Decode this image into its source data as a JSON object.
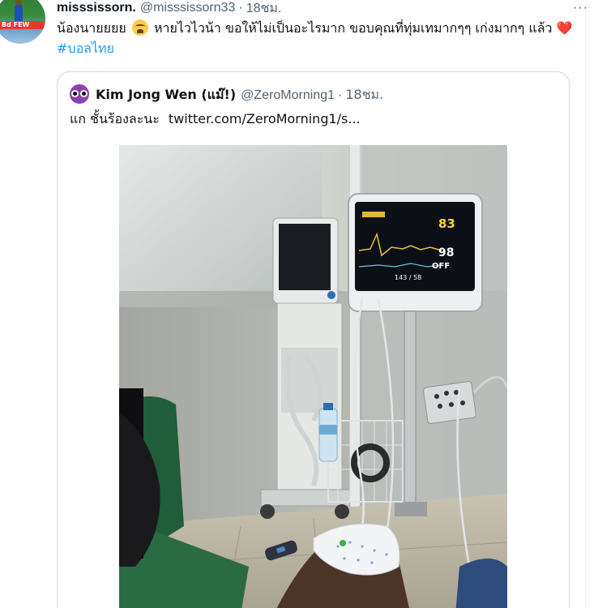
{
  "tweet": {
    "display_name": "misssissorn.",
    "handle": "@misssissorn33",
    "separator": "·",
    "time": "18ชม.",
    "more": "···",
    "text_part1": "น้องนายยยย ",
    "emoji": "tired-face-emoji",
    "text_part2": " หายไวไวน้า ขอให้ไม่เป็นอะไรมาก ขอบคุณที่ทุ่มเทมากๆๆ เก่งมากๆ แล้ว ",
    "heart": "❤️",
    "hashtag": "#บอลไทย",
    "avatar_banner_text": "Bd FEW"
  },
  "quoted": {
    "display_name": "Kim Jong Wen (แม๊!)",
    "handle": "@ZeroMorning1",
    "separator": "·",
    "time": "18ชม.",
    "text": "แก ชั้นร้องละนะ",
    "link": "twitter.com/ZeroMorning1/s..."
  },
  "photo": {
    "monitor_hr": "83",
    "monitor_spo2": "98",
    "monitor_off": "OFF",
    "monitor_bp": "143 / 58"
  },
  "colors": {
    "accent": "#1d9bf0",
    "secondary_text": "#536471",
    "heart": "#e0245e",
    "border": "#cfd9de"
  }
}
